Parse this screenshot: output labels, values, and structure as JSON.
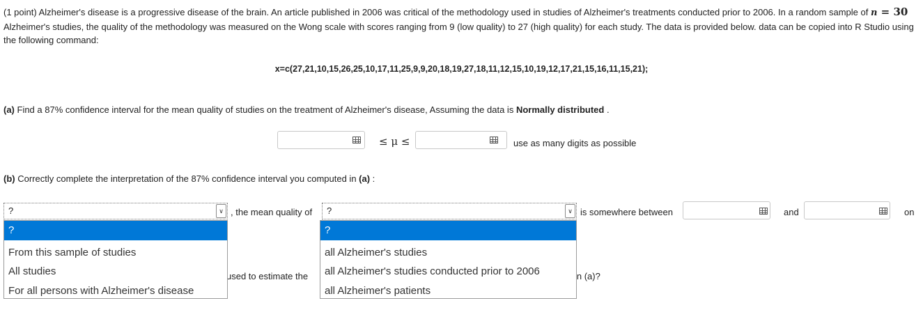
{
  "question": {
    "intro_part1": "(1 point) Alzheimer's disease is a progressive disease of the brain. An article published in 2006 was critical of the methodology used in studies of Alzheimer's treatments conducted prior to 2006. In a random sample of ",
    "n_var": "n",
    "n_eq": " = 30",
    "intro_part2": " Alzheimer's studies, the quality of the methodology was measured on the Wong scale with scores ranging from 9 (low quality) to 27 (high quality) for each study. The data is provided below. data can be copied into R Studio using the following command:",
    "r_command": "x=c(27,21,10,15,26,25,10,17,11,25,9,9,20,18,19,27,18,11,12,15,10,19,12,17,21,15,16,11,15,21);"
  },
  "part_a": {
    "label": "(a)",
    "text": " Find a 87% confidence interval for the mean quality of studies on the treatment of Alzheimer's disease, Assuming the data is ",
    "bold_text": "Normally distributed",
    "end": " .",
    "lower_value": "",
    "upper_value": "",
    "inequality": "≤ μ ≤",
    "hint": "use as many digits as possible"
  },
  "part_b": {
    "label": "(b)",
    "text": " Correctly complete the interpretation of the 87% confidence interval you computed in ",
    "ref": "(a)",
    "colon": " :",
    "select1_value": "?",
    "mid_text": ", the mean quality of",
    "select2_value": "?",
    "between_text": "is somewhere between",
    "lower_value": "",
    "and_text": "and",
    "upper_value": "",
    "on_text": "on",
    "hidden_text1": "used to estimate the ",
    "hidden_text2": "in (a)?"
  },
  "dropdown1": {
    "options": [
      "?",
      "From this sample of studies",
      "All studies",
      "For all persons with Alzheimer's disease"
    ],
    "selected_index": 0
  },
  "dropdown2": {
    "options": [
      "?",
      "all Alzheimer's studies",
      "all Alzheimer's studies conducted prior to 2006",
      "all Alzheimer's patients"
    ],
    "selected_index": 0
  }
}
